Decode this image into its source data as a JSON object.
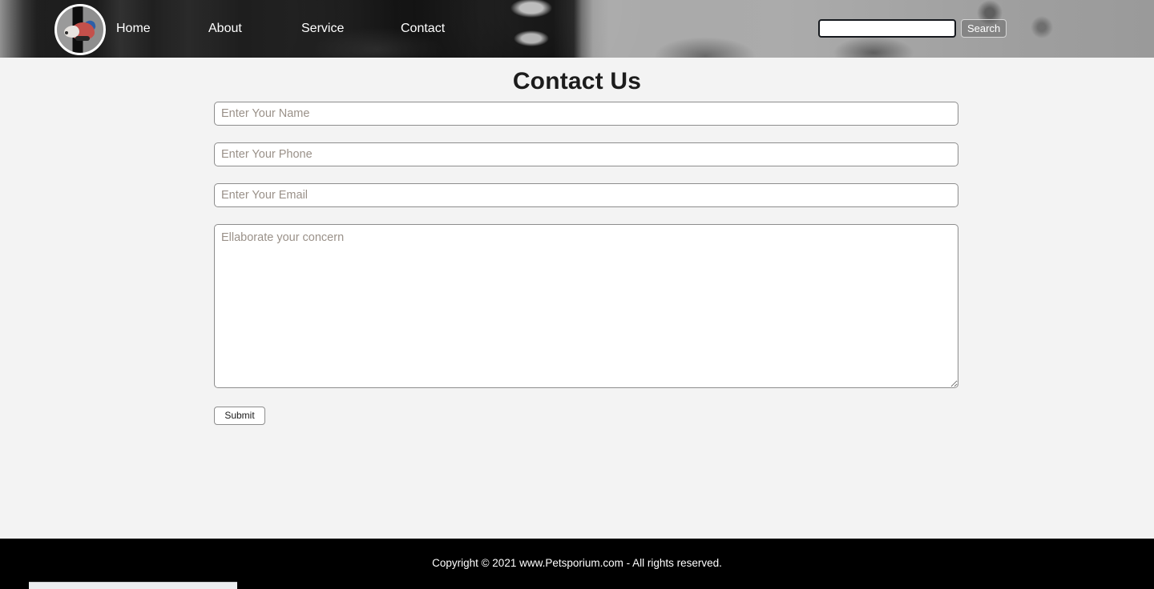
{
  "site": {
    "logo_alt": "Petsporium pet logo"
  },
  "nav": {
    "items": [
      {
        "label": "Home",
        "name": "nav-link-home"
      },
      {
        "label": "About",
        "name": "nav-link-about"
      },
      {
        "label": "Service",
        "name": "nav-link-service"
      },
      {
        "label": "Contact",
        "name": "nav-link-contact"
      }
    ],
    "search": {
      "value": "",
      "placeholder": "",
      "button_label": "Search"
    }
  },
  "main": {
    "title": "Contact Us",
    "form": {
      "name_placeholder": "Enter Your Name",
      "name_value": "",
      "phone_placeholder": "Enter Your Phone",
      "phone_value": "",
      "email_placeholder": "Enter Your Email",
      "email_value": "",
      "message_placeholder": "Ellaborate your concern",
      "message_value": "",
      "submit_label": "Submit"
    }
  },
  "footer": {
    "copyright": "Copyright © 2021 www.Petsporium.com - All rights reserved."
  },
  "colors": {
    "page_background": "#f3f3f3",
    "navbar_background": "#0a0a0a",
    "footer_background": "#000000",
    "field_border": "#8d8d8d",
    "placeholder_text": "#9a9189",
    "title_text": "#1c1c1c",
    "logo_ring": "#ffffff",
    "logo_body": "#c4504b",
    "logo_ear": "#2d5fa8"
  }
}
